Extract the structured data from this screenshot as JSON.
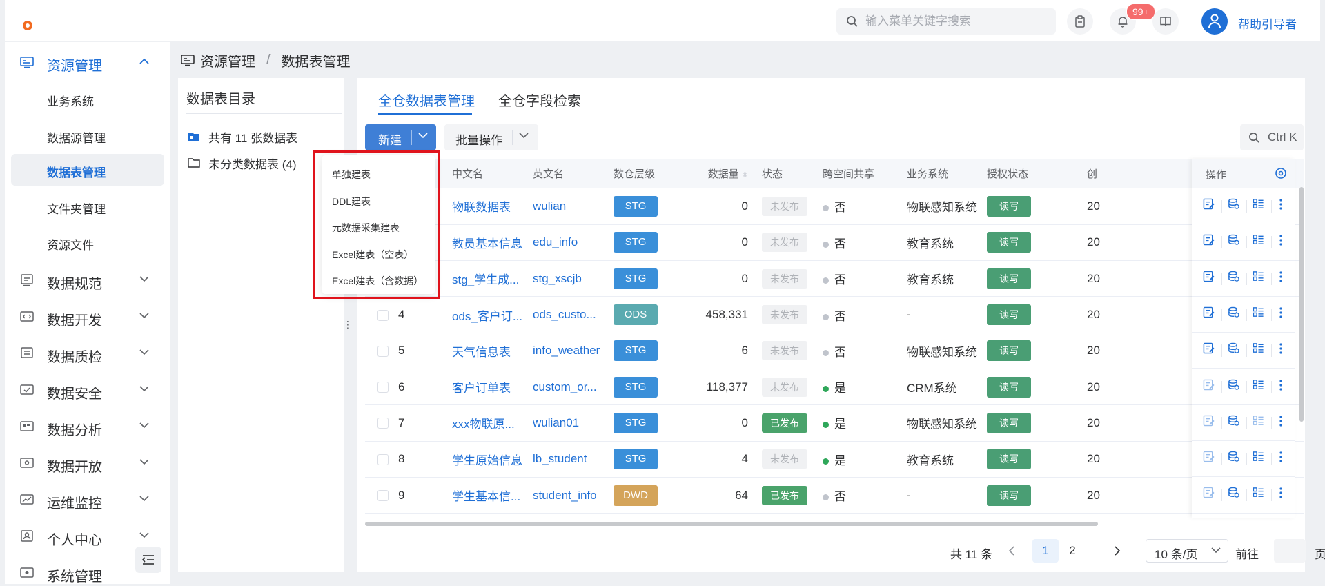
{
  "header": {
    "search_placeholder": "输入菜单关键字搜索",
    "notification_badge": "99+",
    "username": "帮助引导者"
  },
  "sidebar": {
    "groups": [
      {
        "label": "资源管理",
        "icon": "monitor-icon",
        "expanded": true
      },
      {
        "label": "数据规范",
        "icon": "document-icon"
      },
      {
        "label": "数据开发",
        "icon": "code-icon"
      },
      {
        "label": "数据质检",
        "icon": "checklist-icon"
      },
      {
        "label": "数据安全",
        "icon": "shield-icon"
      },
      {
        "label": "数据分析",
        "icon": "analysis-icon"
      },
      {
        "label": "数据开放",
        "icon": "share-icon"
      },
      {
        "label": "运维监控",
        "icon": "chart-line-icon"
      },
      {
        "label": "个人中心",
        "icon": "user-icon"
      },
      {
        "label": "系统管理",
        "icon": "settings-icon"
      }
    ],
    "sub_items": [
      "业务系统",
      "数据源管理",
      "数据表管理",
      "文件夹管理",
      "资源文件"
    ],
    "selected_sub": "数据表管理"
  },
  "breadcrumb": {
    "root": "资源管理",
    "separator": "/",
    "current": "数据表管理"
  },
  "directory": {
    "title": "数据表目录",
    "total_label": "共有 11 张数据表",
    "uncategorized_label": "未分类数据表 (4)"
  },
  "tabs": [
    "全仓数据表管理",
    "全仓字段检索"
  ],
  "toolbar": {
    "new_label": "新建",
    "batch_label": "批量操作",
    "shortcut_label": "Ctrl K"
  },
  "dropdown_menu": [
    "单独建表",
    "DDL建表",
    "元数据采集建表",
    "Excel建表（空表）",
    "Excel建表（含数据）"
  ],
  "table": {
    "columns": [
      "中文名",
      "英文名",
      "数仓层级",
      "数据量",
      "状态",
      "跨空间共享",
      "业务系统",
      "授权状态",
      "创",
      "操作"
    ],
    "rows": [
      {
        "idx": "",
        "cn": "物联数据表",
        "en": "wulian",
        "tier": "STG",
        "count": "0",
        "status": "未发布",
        "shared": "否",
        "system": "物联感知系统",
        "auth": "读写",
        "created": "20"
      },
      {
        "idx": "",
        "cn": "教员基本信息",
        "en": "edu_info",
        "tier": "STG",
        "count": "0",
        "status": "未发布",
        "shared": "否",
        "system": "教育系统",
        "auth": "读写",
        "created": "20"
      },
      {
        "idx": "",
        "cn": "stg_学生成...",
        "en": "stg_xscjb",
        "tier": "STG",
        "count": "0",
        "status": "未发布",
        "shared": "否",
        "system": "教育系统",
        "auth": "读写",
        "created": "20"
      },
      {
        "idx": "4",
        "cn": "ods_客户订...",
        "en": "ods_custo...",
        "tier": "ODS",
        "count": "458,331",
        "status": "未发布",
        "shared": "否",
        "system": "-",
        "auth": "读写",
        "created": "20"
      },
      {
        "idx": "5",
        "cn": "天气信息表",
        "en": "info_weather",
        "tier": "STG",
        "count": "6",
        "status": "未发布",
        "shared": "否",
        "system": "物联感知系统",
        "auth": "读写",
        "created": "20"
      },
      {
        "idx": "6",
        "cn": "客户订单表",
        "en": "custom_or...",
        "tier": "STG",
        "count": "118,377",
        "status": "未发布",
        "shared": "是",
        "system": "CRM系统",
        "auth": "读写",
        "created": "20"
      },
      {
        "idx": "7",
        "cn": "xxx物联原...",
        "en": "wulian01",
        "tier": "STG",
        "count": "0",
        "status": "已发布",
        "shared": "是",
        "system": "物联感知系统",
        "auth": "读写",
        "created": "20"
      },
      {
        "idx": "8",
        "cn": "学生原始信息",
        "en": "lb_student",
        "tier": "STG",
        "count": "4",
        "status": "未发布",
        "shared": "是",
        "system": "教育系统",
        "auth": "读写",
        "created": "20"
      },
      {
        "idx": "9",
        "cn": "学生基本信...",
        "en": "student_info",
        "tier": "DWD",
        "count": "64",
        "status": "已发布",
        "shared": "否",
        "system": "-",
        "auth": "读写",
        "created": "20"
      }
    ]
  },
  "pagination": {
    "total": "共 11 条",
    "pages": [
      "1",
      "2"
    ],
    "current": "1",
    "page_size": "10 条/页",
    "goto_label": "前往",
    "page_suffix": "页"
  },
  "colors": {
    "primary": "#1f6fd6",
    "highlight": "#e0131c",
    "badge": "#f56c6c"
  }
}
